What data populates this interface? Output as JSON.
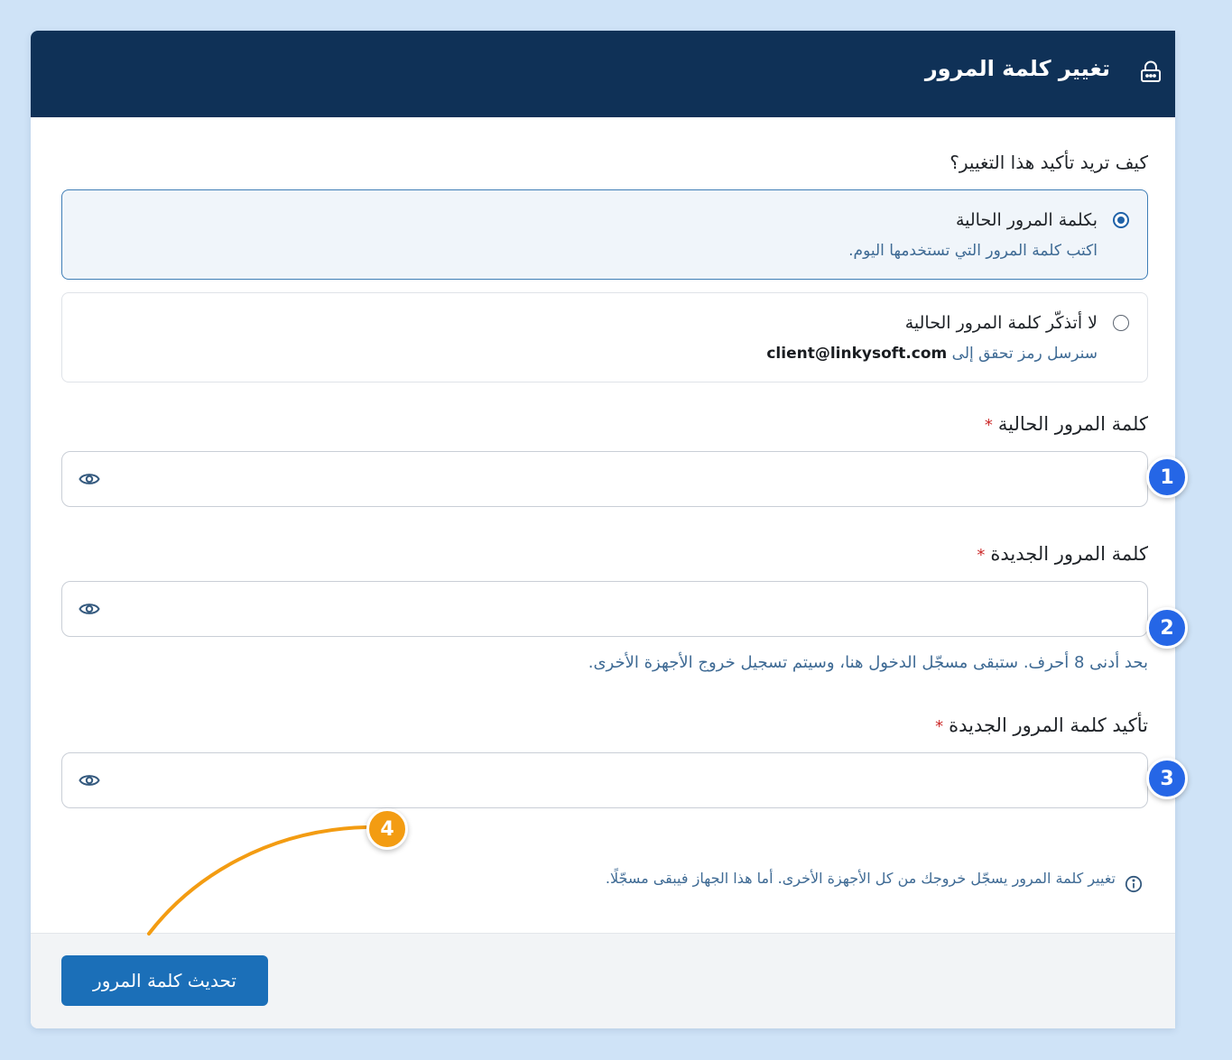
{
  "header": {
    "title": "تغيير كلمة المرور",
    "icon": "lock-icon"
  },
  "verify": {
    "question": "كيف تريد تأكيد هذا التغيير؟",
    "options": [
      {
        "title": "بكلمة المرور الحالية",
        "desc": "اكتب كلمة المرور التي تستخدمها اليوم.",
        "selected": true
      },
      {
        "title": "لا أتذكّر كلمة المرور الحالية",
        "desc": "سنرسل رمز تحقق إلى",
        "email": "client@linkysoft.com",
        "selected": false
      }
    ]
  },
  "fields": {
    "current_label": "كلمة المرور الحالية",
    "new_label": "كلمة المرور الجديدة",
    "confirm_label": "تأكيد كلمة المرور الجديدة",
    "required_mark": "*",
    "new_hint": "بحد أدنى 8 أحرف. ستبقى مسجّل الدخول هنا، وسيتم تسجيل خروج الأجهزة الأخرى."
  },
  "info": {
    "text": "تغيير كلمة المرور يسجّل خروجك من كل الأجهزة الأخرى. أما هذا الجهاز فيبقى مسجّلًا."
  },
  "actions": {
    "submit_label": "تحديث كلمة المرور"
  },
  "annotations": {
    "badges": [
      "1",
      "2",
      "3",
      "4"
    ]
  },
  "colors": {
    "header_bg": "#0f3157",
    "primary": "#1b6fb8",
    "badge_blue": "#2566e6",
    "badge_orange": "#f39c12",
    "required": "#cc2a2a"
  }
}
